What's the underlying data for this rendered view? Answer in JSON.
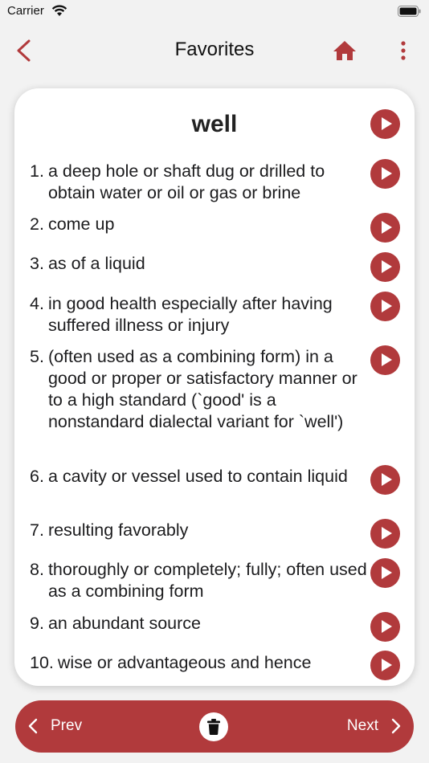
{
  "status_bar": {
    "carrier": "Carrier"
  },
  "nav": {
    "title": "Favorites"
  },
  "colors": {
    "accent": "#b13a3c",
    "background": "#f2f2f2",
    "card": "#ffffff"
  },
  "entry": {
    "word": "well",
    "definitions": [
      {
        "num": "1.",
        "text": "a deep hole or shaft dug or drilled to obtain water or oil or gas or brine"
      },
      {
        "num": "2.",
        "text": "come up"
      },
      {
        "num": "3.",
        "text": "as of a liquid"
      },
      {
        "num": "4.",
        "text": "in good health especially after having suffered illness or injury"
      },
      {
        "num": "5.",
        "text": "(often used as a combining form) in a good or proper or satisfactory manner or to a high standard (`good' is a nonstandard dialectal variant for `well')"
      },
      {
        "num": "6.",
        "text": "a cavity or vessel used to contain liquid"
      },
      {
        "num": "7.",
        "text": "resulting favorably"
      },
      {
        "num": "8.",
        "text": "thoroughly or completely; fully; often used as a combining form"
      },
      {
        "num": "9.",
        "text": "an abundant source"
      },
      {
        "num": "10.",
        "text": "wise or advantageous and hence"
      }
    ]
  },
  "bottom_bar": {
    "prev_label": "Prev",
    "next_label": "Next"
  },
  "icons": {
    "back": "chevron-left-icon",
    "home": "home-icon",
    "more": "more-vertical-icon",
    "play": "play-icon",
    "trash": "trash-icon"
  }
}
